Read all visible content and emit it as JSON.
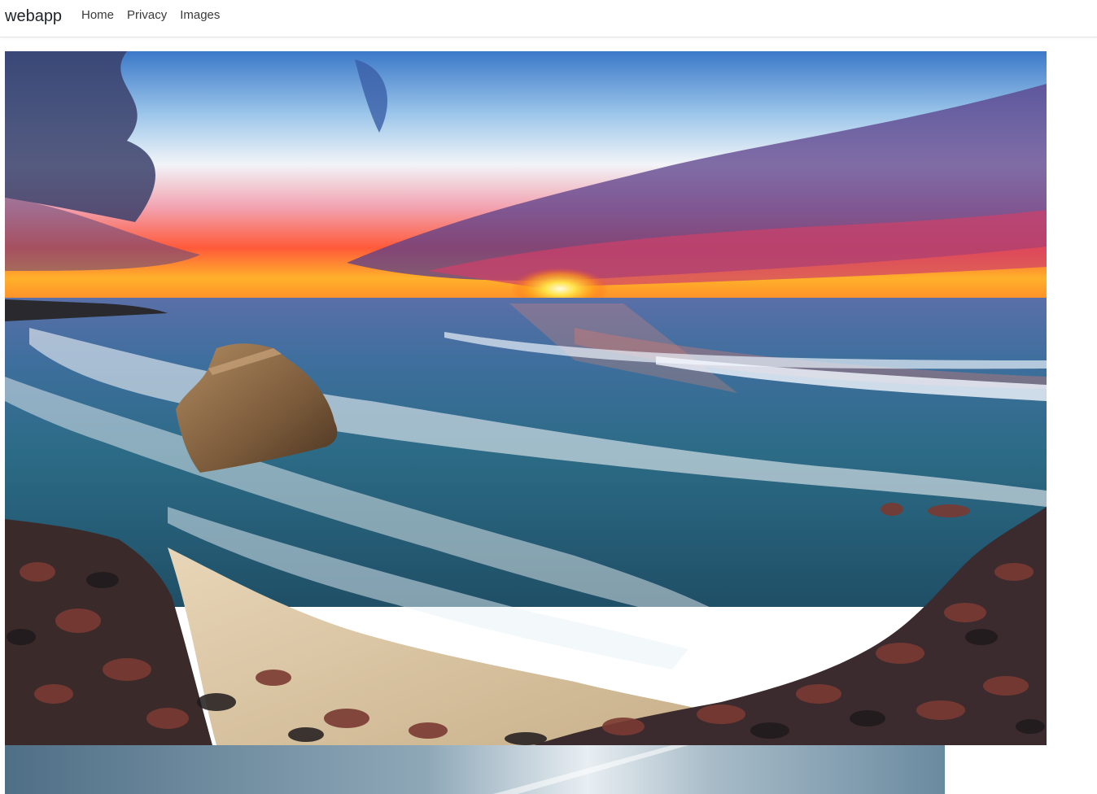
{
  "navbar": {
    "brand": "webapp",
    "links": [
      {
        "label": "Home"
      },
      {
        "label": "Privacy"
      },
      {
        "label": "Images"
      }
    ]
  },
  "gallery": {
    "images": [
      {
        "subject": "sunset over ocean with sea stack rock and rocky shore"
      },
      {
        "subject": "cloudy sky with sun streak"
      }
    ]
  },
  "colors": {
    "brand_text": "#212529",
    "nav_text": "#3a3a3a",
    "navbar_border": "#e5e5e5"
  }
}
